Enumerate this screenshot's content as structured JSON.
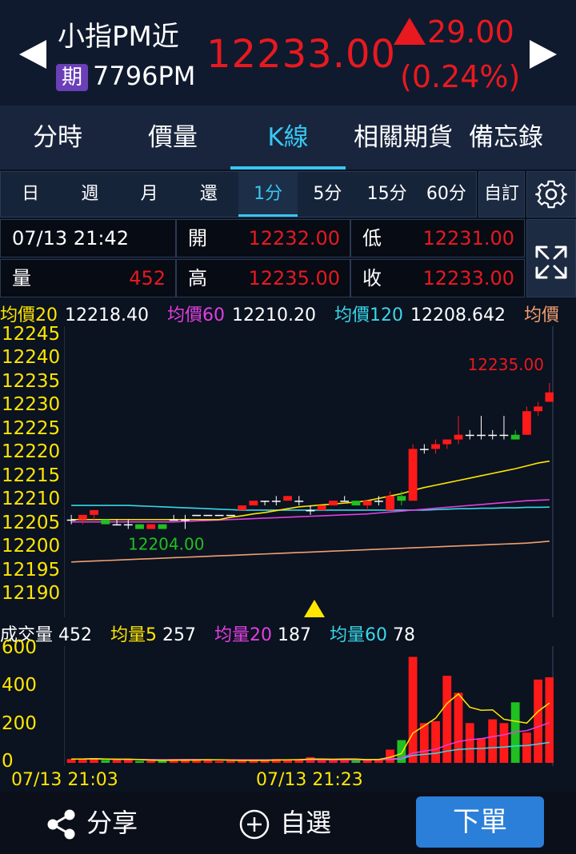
{
  "header": {
    "symbol_name": "小指PM近",
    "badge": "期",
    "symbol_code": "7796PM",
    "last_price": "12233.00",
    "change": "29.00",
    "change_pct": "(0.24%)",
    "up_color": "#e8191f"
  },
  "tabs": [
    {
      "label": "分時"
    },
    {
      "label": "價量"
    },
    {
      "label": "K線"
    },
    {
      "label": "相關期貨"
    },
    {
      "label": "備忘錄"
    }
  ],
  "active_tab": "K線",
  "periods": [
    "日",
    "週",
    "月",
    "還",
    "1分",
    "5分",
    "15分",
    "60分"
  ],
  "active_period": "1分",
  "custom_label": "自訂",
  "info": {
    "datetime": "07/13 21:42",
    "volume_label": "量",
    "volume": "452",
    "open_label": "開",
    "open": "12232.00",
    "high_label": "高",
    "high": "12235.00",
    "low_label": "低",
    "low": "12231.00",
    "close_label": "收",
    "close": "12233.00"
  },
  "ma_legend": {
    "ma20_label": "均價20",
    "ma20": "12218.40",
    "ma60_label": "均價60",
    "ma60": "12210.20",
    "ma120_label": "均價120",
    "ma120": "12208.642",
    "ma240_label": "均價"
  },
  "price_axis": [
    "12245",
    "12240",
    "12235",
    "12230",
    "12225",
    "12220",
    "12215",
    "12210",
    "12205",
    "12200",
    "12195",
    "12190"
  ],
  "annotations": {
    "high_mark": "12235.00",
    "low_mark": "12204.00"
  },
  "volume_legend": {
    "vol_label": "成交量",
    "vol": "452",
    "v5_label": "均量5",
    "v5": "257",
    "v20_label": "均量20",
    "v20": "187",
    "v60_label": "均量60",
    "v60": "78"
  },
  "volume_axis": [
    "600",
    "400",
    "200",
    "0"
  ],
  "x_axis": [
    "07/13 21:03",
    "07/13 21:23"
  ],
  "bottom": {
    "share": "分享",
    "watchlist": "自選",
    "order": "下單"
  },
  "chart_data": {
    "type": "candlestick",
    "ylim": [
      12190,
      12245
    ],
    "candles": [
      [
        12206,
        12207,
        12205,
        12206
      ],
      [
        12206,
        12207,
        12205,
        12207
      ],
      [
        12207,
        12208,
        12206,
        12208
      ],
      [
        12206,
        12206,
        12205,
        12205
      ],
      [
        12205,
        12206,
        12205,
        12205
      ],
      [
        12205,
        12206,
        12204,
        12205
      ],
      [
        12205,
        12205,
        12204,
        12204
      ],
      [
        12204,
        12205,
        12204,
        12205
      ],
      [
        12205,
        12205,
        12204,
        12204
      ],
      [
        12206,
        12207,
        12206,
        12206
      ],
      [
        12206,
        12207,
        12204,
        12206
      ],
      [
        12207,
        12207,
        12207,
        12207
      ],
      [
        12207,
        12207,
        12207,
        12207
      ],
      [
        12207,
        12207,
        12207,
        12207
      ],
      [
        12207,
        12207,
        12207,
        12207
      ],
      [
        12208,
        12209,
        12208,
        12209
      ],
      [
        12209,
        12210,
        12209,
        12210
      ],
      [
        12210,
        12210,
        12209,
        12210
      ],
      [
        12210,
        12211,
        12209,
        12210
      ],
      [
        12210,
        12211,
        12210,
        12211
      ],
      [
        12210,
        12211,
        12209,
        12210
      ],
      [
        12208,
        12209,
        12207,
        12208
      ],
      [
        12208,
        12209,
        12208,
        12209
      ],
      [
        12209,
        12210,
        12209,
        12210
      ],
      [
        12210,
        12211,
        12210,
        12210
      ],
      [
        12210,
        12210,
        12209,
        12209
      ],
      [
        12209,
        12210,
        12208,
        12210
      ],
      [
        12210,
        12211,
        12209,
        12210
      ],
      [
        12208,
        12212,
        12208,
        12211
      ],
      [
        12211,
        12212,
        12209,
        12210
      ],
      [
        12210,
        12222,
        12210,
        12221
      ],
      [
        12221,
        12222,
        12220,
        12221
      ],
      [
        12221,
        12223,
        12220,
        12222
      ],
      [
        12222,
        12223,
        12221,
        12223
      ],
      [
        12223,
        12228,
        12222,
        12224
      ],
      [
        12224,
        12225,
        12223,
        12224
      ],
      [
        12224,
        12228,
        12223,
        12224
      ],
      [
        12224,
        12225,
        12223,
        12224
      ],
      [
        12224,
        12228,
        12223,
        12224
      ],
      [
        12224,
        12225,
        12223,
        12223
      ],
      [
        12224,
        12230,
        12224,
        12229
      ],
      [
        12229,
        12231,
        12228,
        12230
      ],
      [
        12231,
        12235,
        12231,
        12233
      ]
    ],
    "ma20": [
      12206,
      12206,
      12206,
      12206,
      12206,
      12206,
      12206,
      12206,
      12206,
      12206,
      12206,
      12206,
      12206,
      12206,
      12206.5,
      12206.8,
      12207.2,
      12207.5,
      12207.9,
      12208.3,
      12208.7,
      12208.9,
      12209.1,
      12209.3,
      12209.5,
      12209.7,
      12210,
      12210.5,
      12211,
      12211.5,
      12212.2,
      12212.8,
      12213.3,
      12213.8,
      12214.3,
      12214.8,
      12215.3,
      12215.8,
      12216.3,
      12216.8,
      12217.4,
      12218,
      12218.4
    ],
    "ma60": [
      12205.5,
      12205.5,
      12205.5,
      12205.5,
      12205.5,
      12205.5,
      12205.5,
      12205.5,
      12205.5,
      12205.5,
      12205.6,
      12205.7,
      12205.8,
      12205.9,
      12206,
      12206.1,
      12206.2,
      12206.3,
      12206.4,
      12206.5,
      12206.6,
      12206.7,
      12206.8,
      12206.9,
      12207,
      12207.1,
      12207.2,
      12207.4,
      12207.6,
      12207.8,
      12208,
      12208.2,
      12208.4,
      12208.6,
      12208.8,
      12209,
      12209.2,
      12209.4,
      12209.6,
      12209.8,
      12210,
      12210.1,
      12210.2
    ],
    "ma120": [
      12209,
      12209,
      12209,
      12209,
      12209,
      12209,
      12208.9,
      12208.8,
      12208.7,
      12208.6,
      12208.5,
      12208.4,
      12208.3,
      12208.2,
      12208.1,
      12208,
      12208,
      12208,
      12208,
      12208,
      12208,
      12208,
      12208,
      12208,
      12208,
      12208,
      12208,
      12208,
      12208,
      12208,
      12208,
      12208,
      12208.1,
      12208.2,
      12208.3,
      12208.3,
      12208.4,
      12208.4,
      12208.5,
      12208.5,
      12208.6,
      12208.6,
      12208.642
    ],
    "ma240": [
      12197,
      12197.1,
      12197.2,
      12197.3,
      12197.4,
      12197.5,
      12197.6,
      12197.7,
      12197.8,
      12197.9,
      12198,
      12198.1,
      12198.2,
      12198.3,
      12198.4,
      12198.5,
      12198.6,
      12198.7,
      12198.8,
      12198.9,
      12199,
      12199.1,
      12199.2,
      12199.3,
      12199.4,
      12199.5,
      12199.6,
      12199.7,
      12199.8,
      12199.9,
      12200,
      12200.1,
      12200.2,
      12200.3,
      12200.4,
      12200.5,
      12200.6,
      12200.7,
      12200.8,
      12200.9,
      12201,
      12201.2,
      12201.4
    ],
    "volume": [
      20,
      20,
      25,
      15,
      15,
      20,
      10,
      10,
      10,
      20,
      20,
      15,
      15,
      10,
      10,
      15,
      15,
      15,
      20,
      15,
      20,
      30,
      15,
      15,
      20,
      20,
      15,
      20,
      70,
      120,
      560,
      210,
      220,
      460,
      370,
      210,
      130,
      230,
      210,
      320,
      160,
      440,
      452
    ],
    "vol_ylim": [
      0,
      600
    ]
  }
}
